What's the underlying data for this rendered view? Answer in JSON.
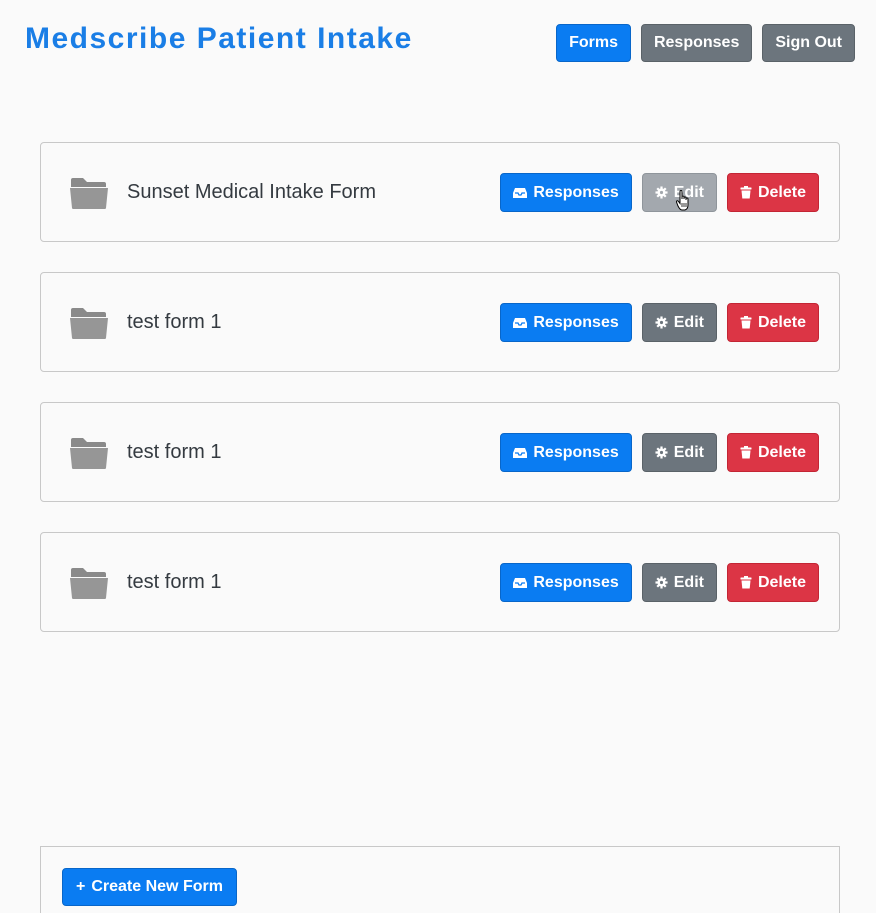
{
  "header": {
    "title": "Medscribe Patient Intake",
    "nav": {
      "forms_label": "Forms",
      "responses_label": "Responses",
      "signout_label": "Sign Out"
    }
  },
  "forms": [
    {
      "name": "Sunset Medical Intake Form",
      "responses_label": "Responses",
      "edit_label": "Edit",
      "delete_label": "Delete",
      "edit_state": "hover"
    },
    {
      "name": "test form 1",
      "responses_label": "Responses",
      "edit_label": "Edit",
      "delete_label": "Delete"
    },
    {
      "name": "test form 1",
      "responses_label": "Responses",
      "edit_label": "Edit",
      "delete_label": "Delete"
    },
    {
      "name": "test form 1",
      "responses_label": "Responses",
      "edit_label": "Edit",
      "delete_label": "Delete"
    }
  ],
  "footer": {
    "create_label": "Create New Form",
    "create_icon": "+"
  },
  "colors": {
    "title": "#1a7ee6",
    "primary": "#0a7cf2",
    "secondary": "#6c757d",
    "danger": "#dc3545",
    "background": "#fafafa"
  },
  "icons": [
    "folder-icon",
    "inbox-icon",
    "gear-icon",
    "trash-icon",
    "plus-icon",
    "hand-cursor-icon"
  ]
}
